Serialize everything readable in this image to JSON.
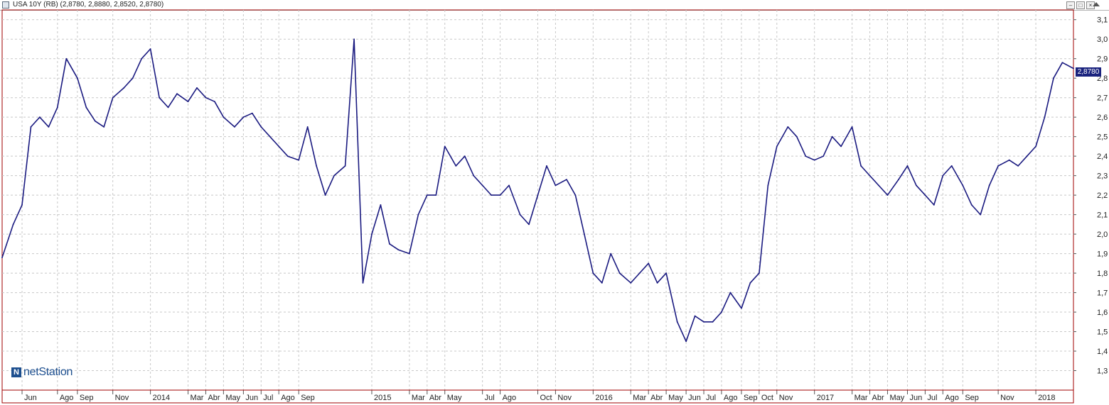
{
  "window": {
    "title": "USA 10Y (RB) (2,8780, 2,8880, 2,8520, 2,8780)"
  },
  "logo": {
    "brand_light": "net",
    "brand_bold": "Station"
  },
  "price_tag": "2,8780",
  "colors": {
    "series": "#1a1a80",
    "frame": "#a00000",
    "grid": "#c8c8c8",
    "price_tag": "#1a237e"
  },
  "chart_data": {
    "type": "line",
    "title": "USA 10Y (RB) (2,8780, 2,8880, 2,8520, 2,8780)",
    "xlabel": "",
    "ylabel": "",
    "ylim": [
      1.2,
      3.15
    ],
    "grid": true,
    "y_ticks": [
      "1,3",
      "1,4",
      "1,5",
      "1,6",
      "1,7",
      "1,8",
      "1,9",
      "2,0",
      "2,1",
      "2,2",
      "2,3",
      "2,4",
      "2,5",
      "2,6",
      "2,7",
      "2,8",
      "2,9",
      "3,0",
      "3,1"
    ],
    "x_ticks": [
      "Jun",
      "Ago",
      "Sep",
      "Nov",
      "2014",
      "Mar",
      "Abr",
      "May",
      "Jun",
      "Jul",
      "Ago",
      "Sep",
      "2015",
      "Mar",
      "Abr",
      "May",
      "Jul",
      "Ago",
      "Oct",
      "Nov",
      "2016",
      "Mar",
      "Abr",
      "May",
      "Jun",
      "Jul",
      "Ago",
      "Sep",
      "Oct",
      "Nov",
      "2017",
      "Mar",
      "Abr",
      "May",
      "Jun",
      "Jul",
      "Ago",
      "Sep",
      "Nov",
      "2018"
    ],
    "x_tick_months": [
      2013.42,
      2013.58,
      2013.67,
      2013.83,
      2014.0,
      2014.17,
      2014.25,
      2014.33,
      2014.42,
      2014.5,
      2014.58,
      2014.67,
      2015.0,
      2015.17,
      2015.25,
      2015.33,
      2015.5,
      2015.58,
      2015.75,
      2015.83,
      2016.0,
      2016.17,
      2016.25,
      2016.33,
      2016.42,
      2016.5,
      2016.58,
      2016.67,
      2016.75,
      2016.83,
      2017.0,
      2017.17,
      2017.25,
      2017.33,
      2017.42,
      2017.5,
      2017.58,
      2017.67,
      2017.83,
      2018.0
    ],
    "series": [
      {
        "name": "",
        "x": [
          2013.33,
          2013.38,
          2013.42,
          2013.46,
          2013.5,
          2013.54,
          2013.58,
          2013.62,
          2013.67,
          2013.71,
          2013.75,
          2013.79,
          2013.83,
          2013.88,
          2013.92,
          2013.96,
          2014.0,
          2014.04,
          2014.08,
          2014.12,
          2014.17,
          2014.21,
          2014.25,
          2014.29,
          2014.33,
          2014.38,
          2014.42,
          2014.46,
          2014.5,
          2014.54,
          2014.58,
          2014.62,
          2014.67,
          2014.71,
          2014.75,
          2014.79,
          2014.83,
          2014.88,
          2014.92,
          2014.96,
          2015.0,
          2015.04,
          2015.08,
          2015.12,
          2015.17,
          2015.21,
          2015.25,
          2015.29,
          2015.33,
          2015.38,
          2015.42,
          2015.46,
          2015.5,
          2015.54,
          2015.58,
          2015.62,
          2015.67,
          2015.71,
          2015.75,
          2015.79,
          2015.83,
          2015.88,
          2015.92,
          2015.96,
          2016.0,
          2016.04,
          2016.08,
          2016.12,
          2016.17,
          2016.21,
          2016.25,
          2016.29,
          2016.33,
          2016.38,
          2016.42,
          2016.46,
          2016.5,
          2016.54,
          2016.58,
          2016.62,
          2016.67,
          2016.71,
          2016.75,
          2016.79,
          2016.83,
          2016.88,
          2016.92,
          2016.96,
          2017.0,
          2017.04,
          2017.08,
          2017.12,
          2017.17,
          2017.21,
          2017.25,
          2017.29,
          2017.33,
          2017.38,
          2017.42,
          2017.46,
          2017.5,
          2017.54,
          2017.58,
          2017.62,
          2017.67,
          2017.71,
          2017.75,
          2017.79,
          2017.83,
          2017.88,
          2017.92,
          2017.96,
          2018.0,
          2018.04,
          2018.08,
          2018.12,
          2018.17
        ],
        "y": [
          1.88,
          2.05,
          2.15,
          2.55,
          2.6,
          2.55,
          2.65,
          2.9,
          2.8,
          2.65,
          2.58,
          2.55,
          2.7,
          2.75,
          2.8,
          2.9,
          2.95,
          2.7,
          2.65,
          2.72,
          2.68,
          2.75,
          2.7,
          2.68,
          2.6,
          2.55,
          2.6,
          2.62,
          2.55,
          2.5,
          2.45,
          2.4,
          2.38,
          2.55,
          2.35,
          2.2,
          2.3,
          2.35,
          3.0,
          1.75,
          2.0,
          2.15,
          1.95,
          1.92,
          1.9,
          2.1,
          2.2,
          2.2,
          2.45,
          2.35,
          2.4,
          2.3,
          2.25,
          2.2,
          2.2,
          2.25,
          2.1,
          2.05,
          2.2,
          2.35,
          2.25,
          2.28,
          2.2,
          2.0,
          1.8,
          1.75,
          1.9,
          1.8,
          1.75,
          1.8,
          1.85,
          1.75,
          1.8,
          1.55,
          1.45,
          1.58,
          1.55,
          1.55,
          1.6,
          1.7,
          1.62,
          1.75,
          1.8,
          2.25,
          2.45,
          2.55,
          2.5,
          2.4,
          2.38,
          2.4,
          2.5,
          2.45,
          2.55,
          2.35,
          2.3,
          2.25,
          2.2,
          2.28,
          2.35,
          2.25,
          2.2,
          2.15,
          2.3,
          2.35,
          2.25,
          2.15,
          2.1,
          2.25,
          2.35,
          2.38,
          2.35,
          2.4,
          2.45,
          2.6,
          2.8,
          2.88,
          2.85
        ]
      }
    ]
  }
}
